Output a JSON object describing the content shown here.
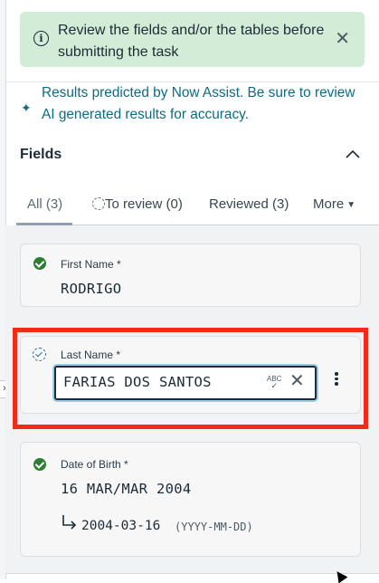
{
  "notice": {
    "message": "Review the fields and/or the tables before submitting the task",
    "icon": "info-icon",
    "bg_color": "#d2ecd8"
  },
  "ai_banner": {
    "message": "Results predicted by Now Assist. Be sure to review AI generated results for accuracy.",
    "icon": "sparkle-icon",
    "color": "#0b6b84"
  },
  "fields_section": {
    "title": "Fields"
  },
  "tabs": {
    "all": "All (3)",
    "to_review": "To review (0)",
    "reviewed": "Reviewed (3)",
    "more": "More"
  },
  "fields": {
    "first_name": {
      "label": "First Name *",
      "value": "RODRIGO",
      "status": "reviewed"
    },
    "last_name": {
      "label": "Last Name *",
      "value": "FARIAS DOS SANTOS",
      "status": "predicted",
      "spellcheck_label": "ABC"
    },
    "date_of_birth": {
      "label": "Date of Birth *",
      "value": "16 MAR/MAR 2004",
      "normalized": "2004-03-16",
      "format_hint": "(YYYY-MM-DD)",
      "status": "reviewed"
    }
  },
  "colors": {
    "highlight": "#ef2b1c",
    "success": "#2e7d32"
  }
}
